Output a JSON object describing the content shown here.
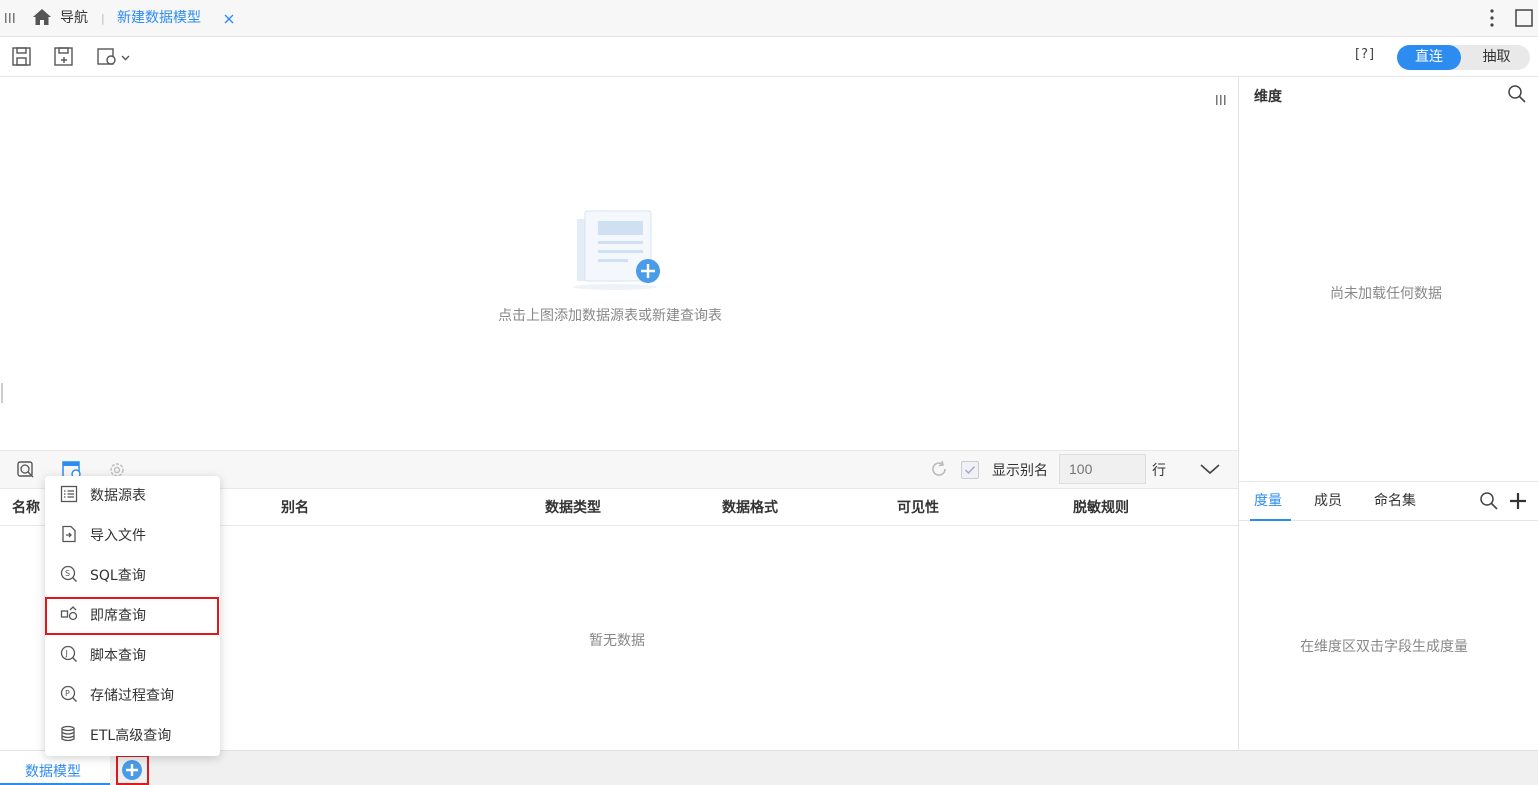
{
  "tabs": {
    "home": "导航",
    "active": "新建数据模型"
  },
  "toolbar": {
    "help": "[?]",
    "mode_direct": "直连",
    "mode_extract": "抽取"
  },
  "canvas": {
    "hint": "点击上图添加数据源表或新建查询表"
  },
  "table_toolbar": {
    "show_alias_label": "显示别名",
    "rows_placeholder": "100",
    "rows_unit": "行"
  },
  "table": {
    "columns": [
      "名称",
      "别名",
      "数据类型",
      "数据格式",
      "可见性",
      "脱敏规则"
    ],
    "empty": "暂无数据"
  },
  "right_panel": {
    "dimension_title": "维度",
    "dimension_empty": "尚未加载任何数据",
    "tabs": [
      "度量",
      "成员",
      "命名集"
    ],
    "measure_empty": "在维度区双击字段生成度量"
  },
  "menu": {
    "items": [
      {
        "label": "数据源表",
        "icon": "table-list-icon"
      },
      {
        "label": "导入文件",
        "icon": "import-file-icon"
      },
      {
        "label": "SQL查询",
        "icon": "sql-query-icon"
      },
      {
        "label": "即席查询",
        "icon": "adhoc-query-icon"
      },
      {
        "label": "脚本查询",
        "icon": "script-query-icon"
      },
      {
        "label": "存储过程查询",
        "icon": "procedure-query-icon"
      },
      {
        "label": "ETL高级查询",
        "icon": "etl-query-icon"
      }
    ],
    "highlighted": "即席查询"
  },
  "footer": {
    "tab": "数据模型"
  },
  "colors": {
    "accent": "#2d8cf0",
    "highlight": "#e0181c"
  }
}
